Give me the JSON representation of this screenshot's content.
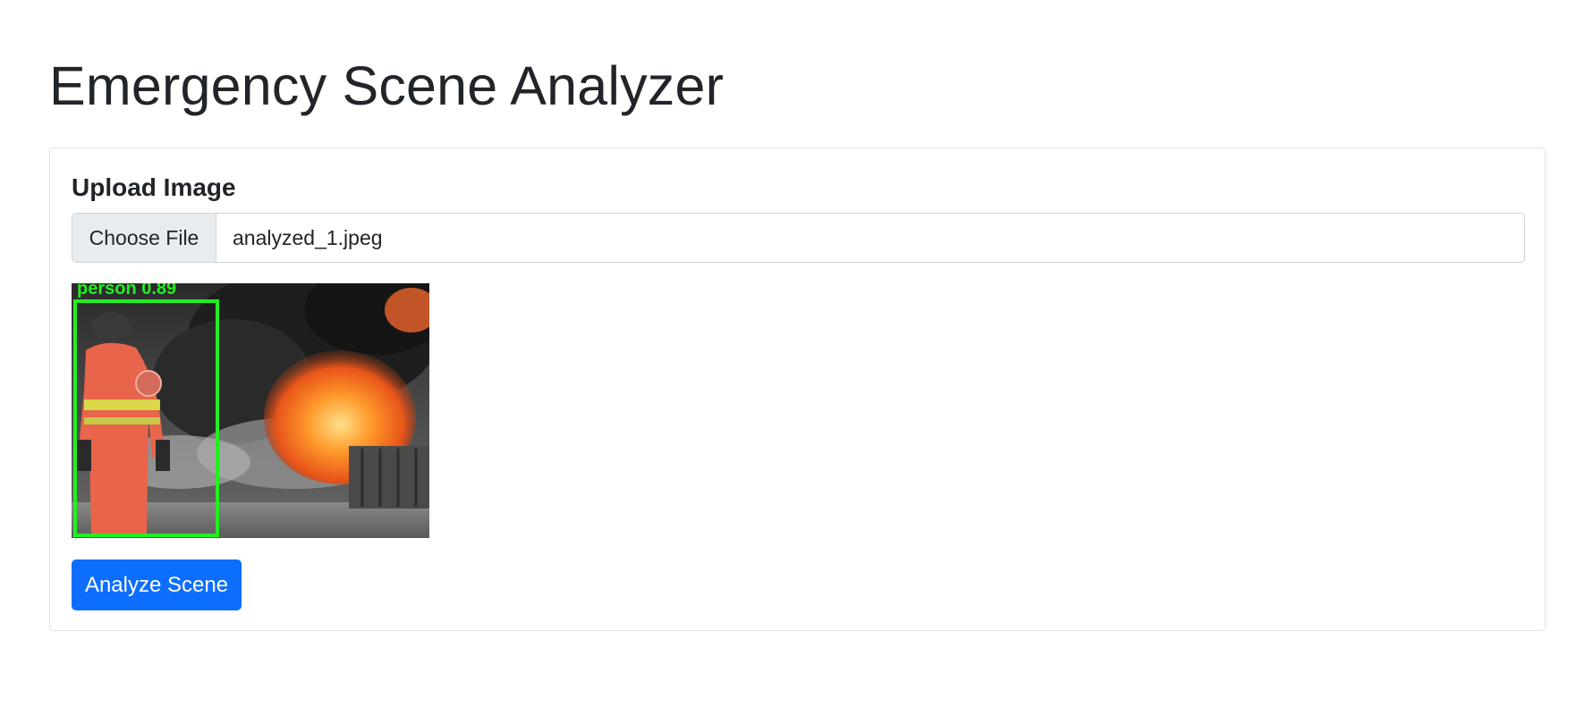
{
  "page": {
    "title": "Emergency Scene Analyzer"
  },
  "upload": {
    "label": "Upload Image",
    "choose_button": "Choose File",
    "file_name": "analyzed_1.jpeg"
  },
  "preview": {
    "detection_label": "person 0.89",
    "box_color": "#22ee22"
  },
  "actions": {
    "analyze_label": "Analyze Scene"
  },
  "colors": {
    "primary": "#0d6efd",
    "text": "#212529",
    "border": "#dee2e6"
  }
}
